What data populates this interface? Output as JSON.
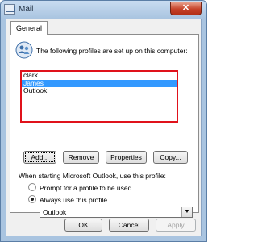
{
  "window": {
    "title": "Mail",
    "close_label": "✕"
  },
  "tabs": [
    {
      "label": "General"
    }
  ],
  "intro_text": "The following profiles are set up on this computer:",
  "profiles": [
    {
      "name": "clark",
      "selected": false
    },
    {
      "name": "James",
      "selected": true
    },
    {
      "name": "Outlook",
      "selected": false
    }
  ],
  "profile_buttons": {
    "add": "Add...",
    "remove": "Remove",
    "properties": "Properties",
    "copy": "Copy..."
  },
  "startup": {
    "label": "When starting Microsoft Outlook, use this profile:",
    "prompt_option": "Prompt for a profile to be used",
    "always_option": "Always use this profile",
    "selected_option": "always",
    "profile_value": "Outlook"
  },
  "dialog_buttons": {
    "ok": "OK",
    "cancel": "Cancel",
    "apply": "Apply"
  },
  "colors": {
    "highlight_border": "#e0121b",
    "selection": "#3399ff"
  }
}
